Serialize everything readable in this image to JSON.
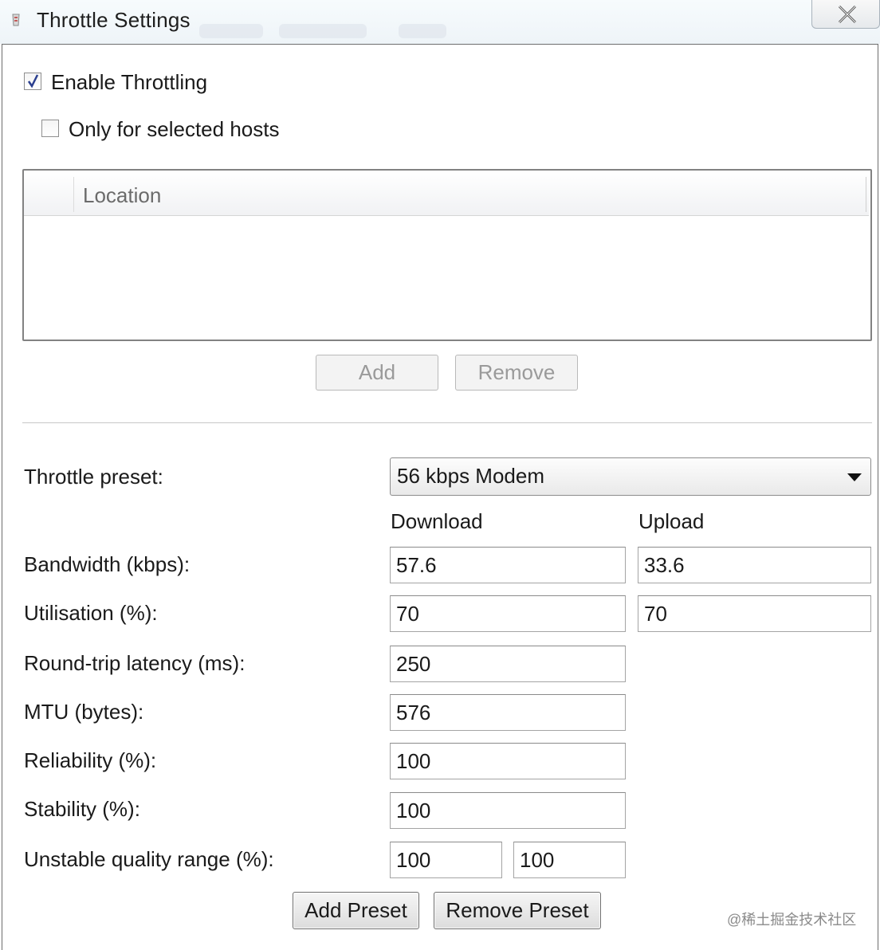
{
  "window": {
    "title": "Throttle Settings",
    "icons": {
      "app": "fiddler-app-icon",
      "close": "close-icon"
    }
  },
  "enable_throttling": {
    "label": "Enable Throttling",
    "checked": true
  },
  "only_selected_hosts": {
    "label": "Only for selected hosts",
    "checked": false
  },
  "hosts_list": {
    "column_header": "Location",
    "rows": []
  },
  "host_buttons": {
    "add": "Add",
    "remove": "Remove"
  },
  "preset": {
    "label": "Throttle preset:",
    "selected": "56 kbps Modem",
    "icon": "dropdown-arrow-icon"
  },
  "columns": {
    "download": "Download",
    "upload": "Upload"
  },
  "settings": {
    "bandwidth": {
      "label": "Bandwidth (kbps):",
      "download": "57.6",
      "upload": "33.6"
    },
    "utilisation": {
      "label": "Utilisation (%):",
      "download": "70",
      "upload": "70"
    },
    "latency": {
      "label": "Round-trip latency (ms):",
      "value": "250"
    },
    "mtu": {
      "label": "MTU (bytes):",
      "value": "576"
    },
    "reliability": {
      "label": "Reliability (%):",
      "value": "100"
    },
    "stability": {
      "label": "Stability (%):",
      "value": "100"
    },
    "unstable_range": {
      "label": "Unstable quality range (%):",
      "min": "100",
      "max": "100"
    }
  },
  "preset_buttons": {
    "add": "Add Preset",
    "remove": "Remove Preset"
  },
  "watermark": "@稀土掘金技术社区"
}
